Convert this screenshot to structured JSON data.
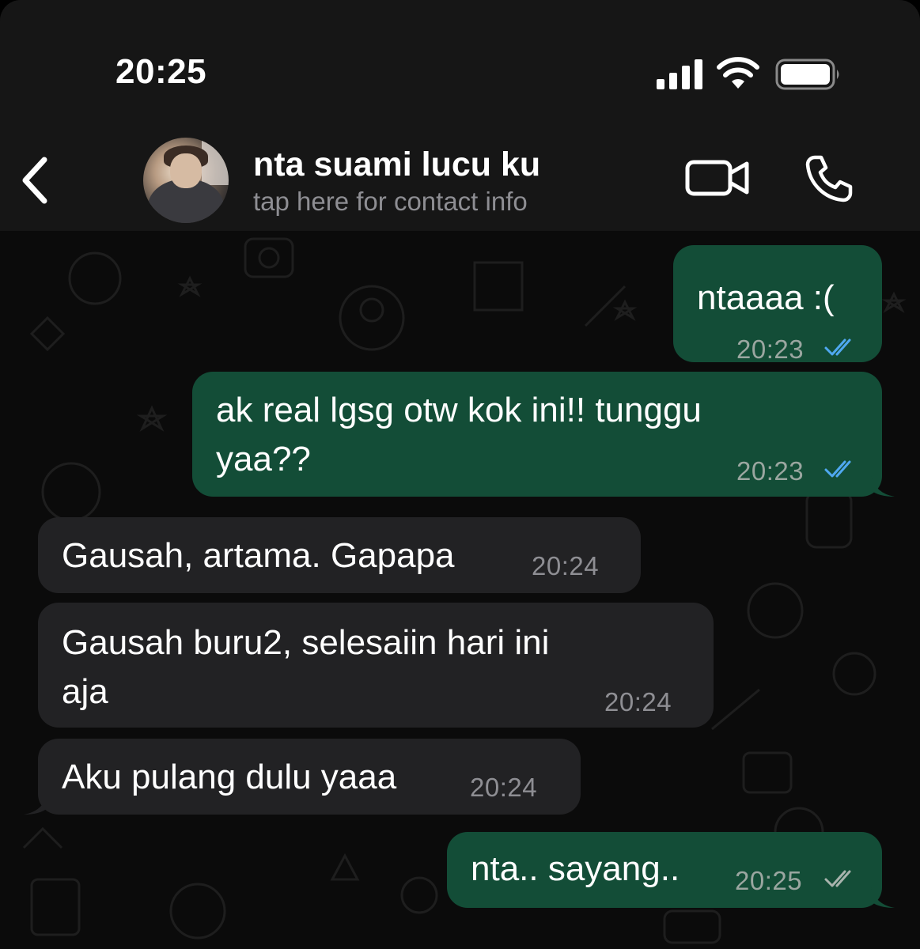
{
  "status_bar": {
    "time": "20:25"
  },
  "header": {
    "contact_name": "nta suami lucu ku",
    "subtitle": "tap here for contact info"
  },
  "messages": [
    {
      "direction": "outgoing",
      "text": "ntaaaa :(",
      "time": "20:23",
      "status": "read"
    },
    {
      "direction": "outgoing",
      "text": "ak real lgsg otw kok ini!! tunggu\nyaa??",
      "time": "20:23",
      "status": "read"
    },
    {
      "direction": "incoming",
      "text": "Gausah, artama. Gapapa",
      "time": "20:24"
    },
    {
      "direction": "incoming",
      "text": "Gausah buru2, selesaiin hari ini\naja",
      "time": "20:24"
    },
    {
      "direction": "incoming",
      "text": "Aku pulang dulu yaaa",
      "time": "20:24"
    },
    {
      "direction": "outgoing",
      "text": "nta.. sayang..",
      "time": "20:25",
      "status": "delivered"
    }
  ],
  "icons": {
    "back": "chevron-left-icon",
    "video": "video-camera-icon",
    "call": "phone-icon",
    "signal": "cellular-signal-icon",
    "wifi": "wifi-icon",
    "battery": "battery-icon",
    "read_receipt": "double-check-icon"
  },
  "colors": {
    "outgoing_bubble": "#134d37",
    "incoming_bubble": "#222224",
    "read_tick": "#4fa8f0",
    "delivered_tick": "#a8b3ad",
    "header_bg": "#161616",
    "chat_bg": "#0b0b0b"
  }
}
